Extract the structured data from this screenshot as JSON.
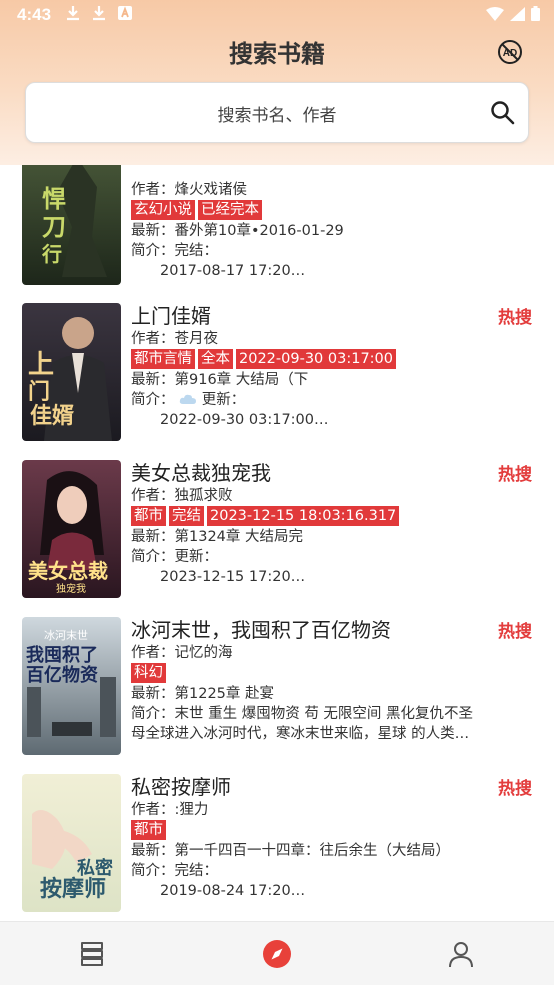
{
  "status": {
    "time": "4:43"
  },
  "header": {
    "title": "搜索书籍",
    "ad_icon": "ad-icon"
  },
  "search": {
    "placeholder": "搜索书名、作者"
  },
  "books": [
    {
      "author": "作者：烽火戏诸侯",
      "tags": [
        "玄幻小说",
        "已经完本"
      ],
      "latest": "最新：番外第10章•2016-01-29",
      "intro_label": "简介：完结：",
      "intro_more": "2017-08-17 17:20…"
    },
    {
      "name": "上门佳婿",
      "author": "作者：苍月夜",
      "tags": [
        "都市言情",
        "全本",
        "2022-09-30 03:17:00"
      ],
      "latest": "最新：第916章 大结局（下",
      "intro_label": "简介：",
      "intro_label2": "更新：",
      "intro_more": "2022-09-30 03:17:00…",
      "hot": "热搜"
    },
    {
      "name": "美女总裁独宠我",
      "author": "作者：独孤求败",
      "tags": [
        "都市",
        "完结",
        "2023-12-15 18:03:16.317"
      ],
      "latest": "最新：第1324章  大结局完",
      "intro_label": "简介：更新：",
      "intro_more": "2023-12-15 17:20…",
      "hot": "热搜"
    },
    {
      "name": "冰河末世，我囤积了百亿物资",
      "author": "作者：记忆的海",
      "tags": [
        "科幻"
      ],
      "latest": "最新：第1225章 赴宴",
      "intro_label": "简介：末世 重生 爆囤物资 苟 无限空间 黑化复仇不圣",
      "intro_more": "母全球进入冰河时代，寒冰末世来临，星球 的人类…",
      "hot": "热搜"
    },
    {
      "name": "私密按摩师",
      "author": "作者：:狸力",
      "tags": [
        "都市"
      ],
      "latest": "最新：第一千四百一十四章：往后余生（大结局）",
      "intro_label": "简介：完结：",
      "intro_more": "2019-08-24 17:20…",
      "hot": "热搜"
    }
  ],
  "nav": {
    "items": [
      "bookshelf-icon",
      "discover-icon",
      "profile-icon"
    ]
  },
  "colors": {
    "tag": "#e1393a",
    "hot": "#e33c3c",
    "accent": "#e8413a"
  }
}
